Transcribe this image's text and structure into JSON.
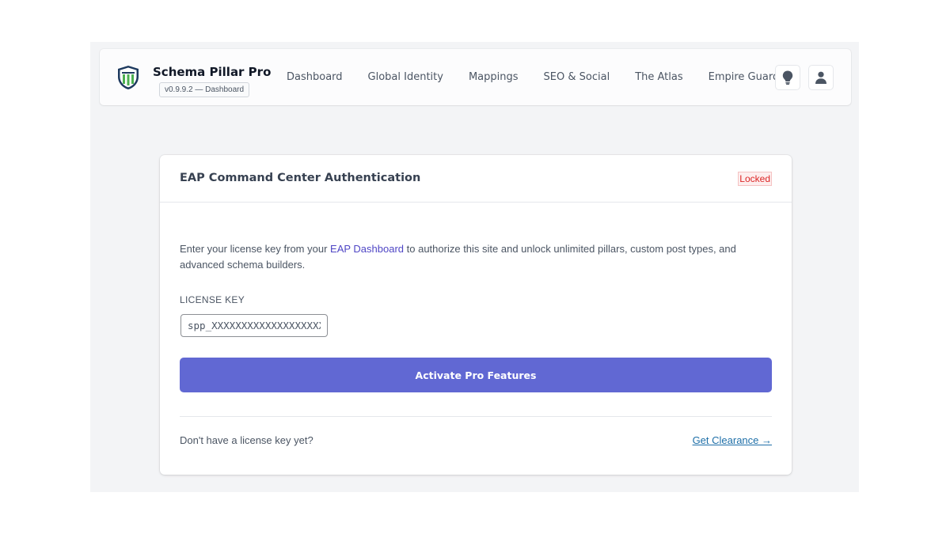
{
  "header": {
    "brand_name": "Schema Pillar Pro",
    "version_badge": "v0.9.9.2 — Dashboard",
    "nav": [
      {
        "label": "Dashboard"
      },
      {
        "label": "Global Identity"
      },
      {
        "label": "Mappings"
      },
      {
        "label": "SEO & Social"
      },
      {
        "label": "The Atlas"
      },
      {
        "label": "Empire Guard"
      }
    ],
    "icons": [
      "lightbulb-icon",
      "user-icon"
    ]
  },
  "card": {
    "title": "EAP Command Center Authentication",
    "status": "Locked",
    "intro_before": "Enter your license key from your ",
    "intro_link": "EAP Dashboard",
    "intro_after": " to authorize this site and unlock unlimited pillars, custom post types, and advanced schema builders.",
    "license_label": "LICENSE KEY",
    "license_placeholder": "spp_XXXXXXXXXXXXXXXXXXXXXXXX",
    "activate_label": "Activate Pro Features",
    "footer_note": "Don't have a license key yet?",
    "clearance_link": "Get Clearance →"
  },
  "colors": {
    "accent": "#6168d3",
    "locked_text": "#dc2626",
    "link": "#1e6fa8",
    "frame_bg": "#f3f4f6"
  }
}
